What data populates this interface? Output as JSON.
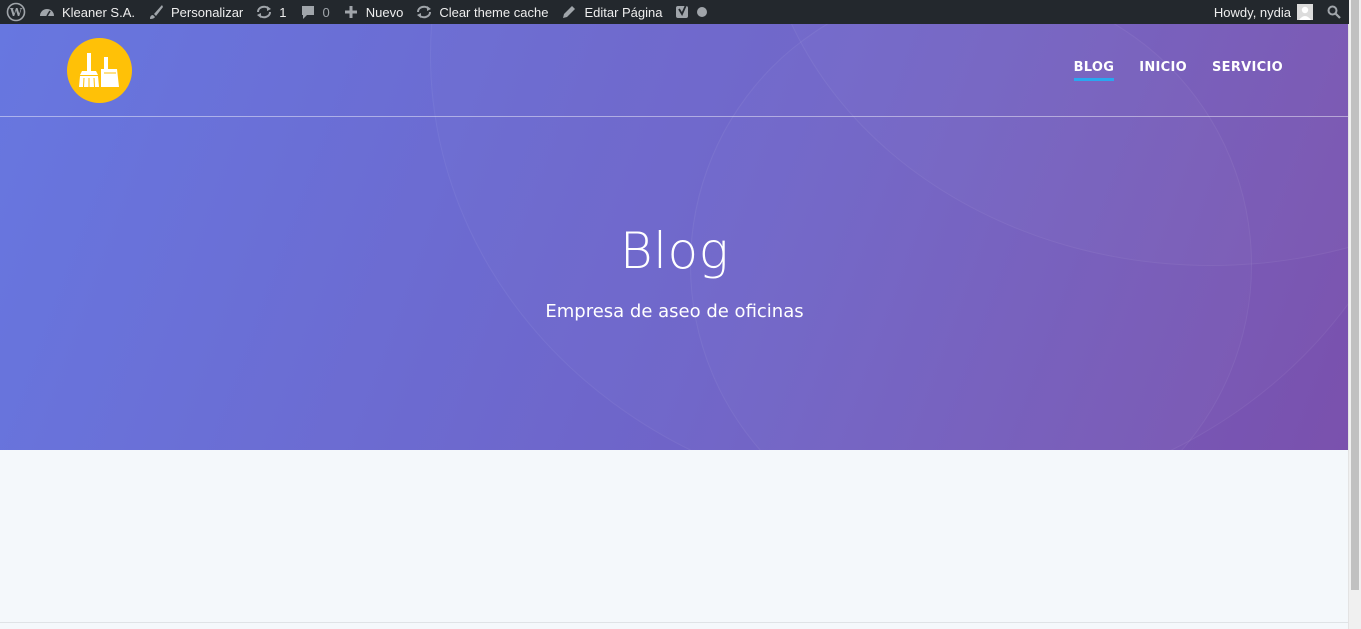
{
  "adminbar": {
    "site_name": "Kleaner S.A.",
    "customize": "Personalizar",
    "updates_count": "1",
    "comments_count": "0",
    "new": "Nuevo",
    "clear_cache": "Clear theme cache",
    "edit_page": "Editar Página",
    "howdy": "Howdy, nydia",
    "icons": [
      "wordpress-icon",
      "dashboard-icon",
      "brush-icon",
      "updates-icon",
      "comment-icon",
      "plus-icon",
      "refresh-icon",
      "pencil-icon",
      "yoast-icon",
      "status-dot-icon",
      "avatar-icon",
      "search-icon"
    ]
  },
  "header": {
    "logo_icon": "broom-icon",
    "nav": [
      {
        "label": "BLOG",
        "active": true
      },
      {
        "label": "INICIO",
        "active": false
      },
      {
        "label": "SERVICIO",
        "active": false
      }
    ]
  },
  "hero": {
    "title": "Blog",
    "subtitle": "Empresa de aseo de oficinas"
  },
  "colors": {
    "adminbar_bg": "#23282d",
    "hero_start": "#6777e0",
    "hero_end": "#7a51ad",
    "logo_bg": "#ffc107",
    "nav_active_underline": "#2aa7f0",
    "content_bg": "#f4f8fb"
  }
}
